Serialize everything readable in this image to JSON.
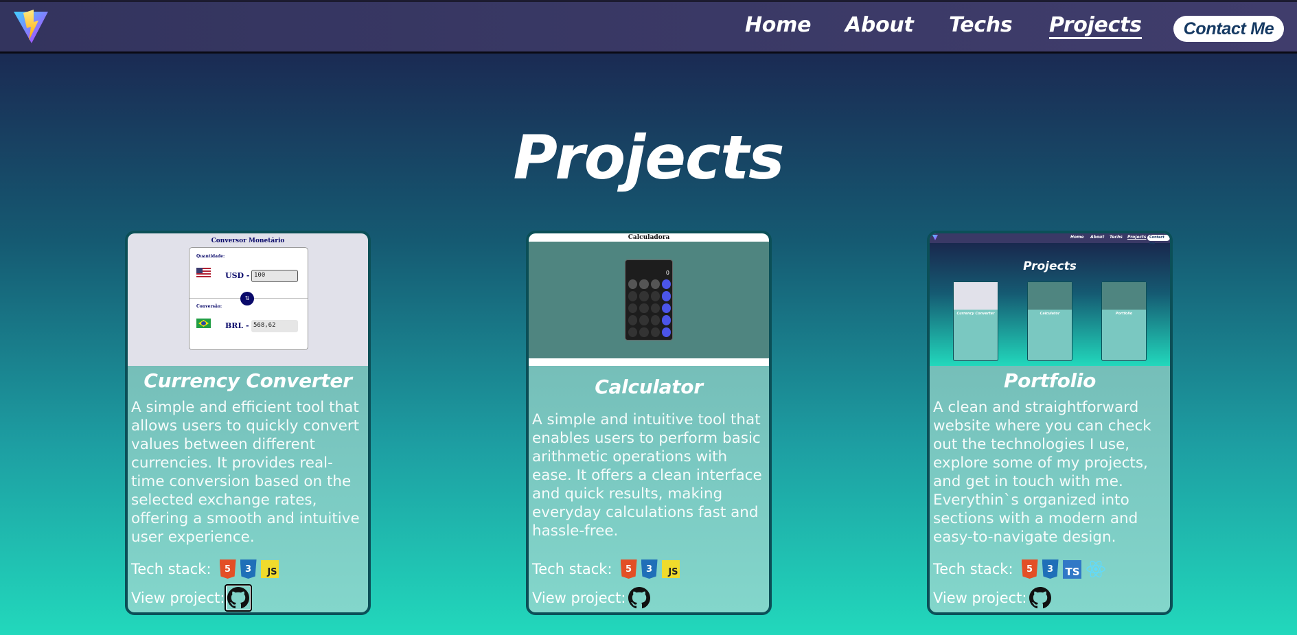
{
  "nav": {
    "links": [
      {
        "label": "Home"
      },
      {
        "label": "About"
      },
      {
        "label": "Techs"
      },
      {
        "label": "Projects"
      }
    ],
    "contact_label": "Contact Me"
  },
  "page": {
    "title": "Projects"
  },
  "cards": [
    {
      "title": "Currency Converter",
      "description": "A simple and efficient tool that allows users to quickly convert values between different currencies. It provides real-time conversion based on the selected exchange rates, offering a smooth and intuitive user experience.",
      "tech_label": "Tech stack:",
      "techs": [
        "HTML5",
        "CSS3",
        "JS"
      ],
      "view_label": "View project:",
      "preview": {
        "heading": "Conversor Monetário",
        "qty_label": "Quantidade:",
        "from_currency": "USD -",
        "from_value": "100",
        "conv_label": "Conversão:",
        "to_currency": "BRL -",
        "to_value": "568,62"
      }
    },
    {
      "title": "Calculator",
      "description": "A simple and intuitive tool that enables users to perform basic arithmetic operations with ease. It offers a clean interface and quick results, making everyday calculations fast and hassle-free.",
      "tech_label": "Tech stack:",
      "techs": [
        "HTML5",
        "CSS3",
        "JS"
      ],
      "view_label": "View project:",
      "preview": {
        "heading": "Calculadora",
        "display": "0"
      }
    },
    {
      "title": "Portfolio",
      "description": "A clean and straightforward website where you can check out the technologies I use, explore some of my projects, and get in touch with me. Everythin`s organized into sections with a modern and easy-to-navigate design.",
      "tech_label": "Tech stack:",
      "techs": [
        "HTML5",
        "CSS3",
        "TS",
        "React"
      ],
      "view_label": "View project:",
      "preview": {
        "nav": [
          "Home",
          "About",
          "Techs",
          "Projects"
        ],
        "contact": "Contact Me",
        "title": "Projects",
        "cards": [
          "Currency Converter",
          "Calculator",
          "Portfolio"
        ]
      }
    }
  ],
  "colors": {
    "nav_bg": "#3a3966",
    "contact_text": "#163a63",
    "card_border": "#0b4f57",
    "html5": "#e34f26",
    "css3": "#1f6fb8",
    "js": "#f0db2c",
    "ts": "#3178c6"
  }
}
